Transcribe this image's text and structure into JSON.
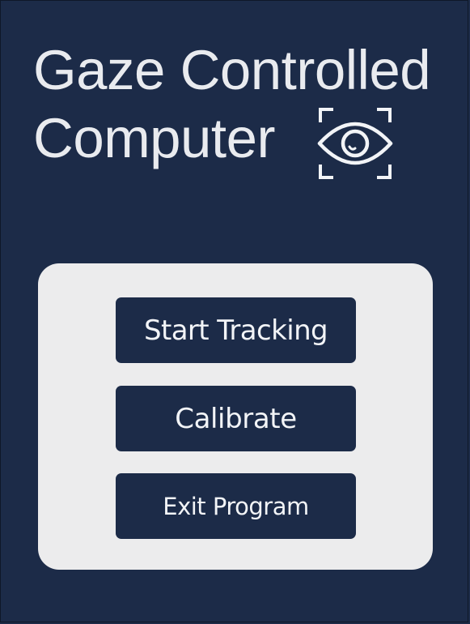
{
  "app": {
    "title_line1": "Gaze Controlled",
    "title_line2": "Computer",
    "icon": "eye-scan-icon"
  },
  "menu": {
    "start_label": "Start Tracking",
    "calibrate_label": "Calibrate",
    "exit_label": "Exit Program"
  },
  "colors": {
    "background": "#1c2b48",
    "panel": "#ececed",
    "button": "#1c2b48",
    "text_light": "#e9ebef"
  }
}
